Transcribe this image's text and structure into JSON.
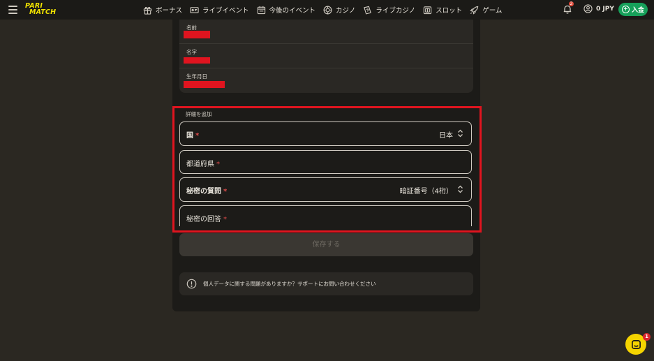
{
  "header": {
    "logo": {
      "line1": "PARI",
      "line2": "MATCH"
    },
    "nav": [
      {
        "label": "ボーナス",
        "icon": "gift-icon"
      },
      {
        "label": "ライブイベント",
        "icon": "live-screen-icon"
      },
      {
        "label": "今後のイベント",
        "icon": "calendar-icon"
      },
      {
        "label": "カジノ",
        "icon": "casino-chip-icon"
      },
      {
        "label": "ライブカジノ",
        "icon": "live-casino-icon"
      },
      {
        "label": "スロット",
        "icon": "slot-icon"
      },
      {
        "label": "ゲーム",
        "icon": "rocket-icon"
      }
    ],
    "notifications_count": "2",
    "balance": "0 JPY",
    "deposit_label": "入金"
  },
  "personal": {
    "first_name_label": "名前",
    "last_name_label": "名字",
    "birthdate_label": "生年月日"
  },
  "details": {
    "section_title": "詳細を追加",
    "country": {
      "label": "国",
      "required": "*",
      "value": "日本"
    },
    "prefecture": {
      "label": "都道府県",
      "required": "*"
    },
    "secret_question": {
      "label": "秘密の質問",
      "required": "*",
      "value": "暗証番号（4桁）"
    },
    "secret_answer": {
      "label": "秘密の回答",
      "required": "*"
    }
  },
  "save_label": "保存する",
  "notice_text": "個人データに関する問題がありますか？サポートにお問い合わせください",
  "chat_badge": "1",
  "colors": {
    "accent_green": "#16a05a",
    "highlight_red": "#e0141f",
    "logo_yellow": "#f1e300",
    "chat_yellow": "#f5d400"
  }
}
